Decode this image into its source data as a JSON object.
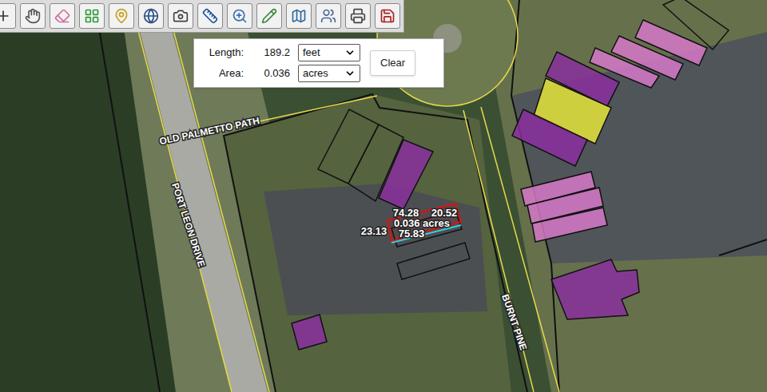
{
  "measure_panel": {
    "rows": [
      {
        "label": "Length:",
        "value": "189.2",
        "unit": "feet"
      },
      {
        "label": "Area:",
        "value": "0.036",
        "unit": "acres"
      }
    ],
    "clear_button": "Clear"
  },
  "map": {
    "roads": [
      {
        "name": "OLD PALMETTO PATH"
      },
      {
        "name": "PORT LEON DRIVE"
      },
      {
        "name": "BURNT PINE"
      }
    ],
    "measurement": {
      "sides": [
        "74.28",
        "20.52",
        "23.13",
        "75.83"
      ],
      "area": "0.036 acres"
    },
    "buildings": [
      {
        "kind": "outline"
      },
      {
        "kind": "outline"
      },
      {
        "kind": "filled",
        "color": "#8a2f9e"
      },
      {
        "kind": "outline"
      },
      {
        "kind": "outline"
      },
      {
        "kind": "filled",
        "color": "#8a2f9e"
      },
      {
        "kind": "filled",
        "color": "#8a2f9e"
      },
      {
        "kind": "filled",
        "color": "#e3e53a"
      },
      {
        "kind": "filled",
        "color": "#8a2f9e"
      },
      {
        "kind": "filled",
        "color": "#d678c8"
      },
      {
        "kind": "filled",
        "color": "#d678c8"
      },
      {
        "kind": "filled",
        "color": "#d678c8"
      },
      {
        "kind": "filled",
        "color": "#d678c8"
      },
      {
        "kind": "filled",
        "color": "#d678c8"
      },
      {
        "kind": "filled",
        "color": "#d678c8"
      },
      {
        "kind": "filled",
        "color": "#8a2f9e"
      },
      {
        "kind": "outline"
      }
    ]
  }
}
